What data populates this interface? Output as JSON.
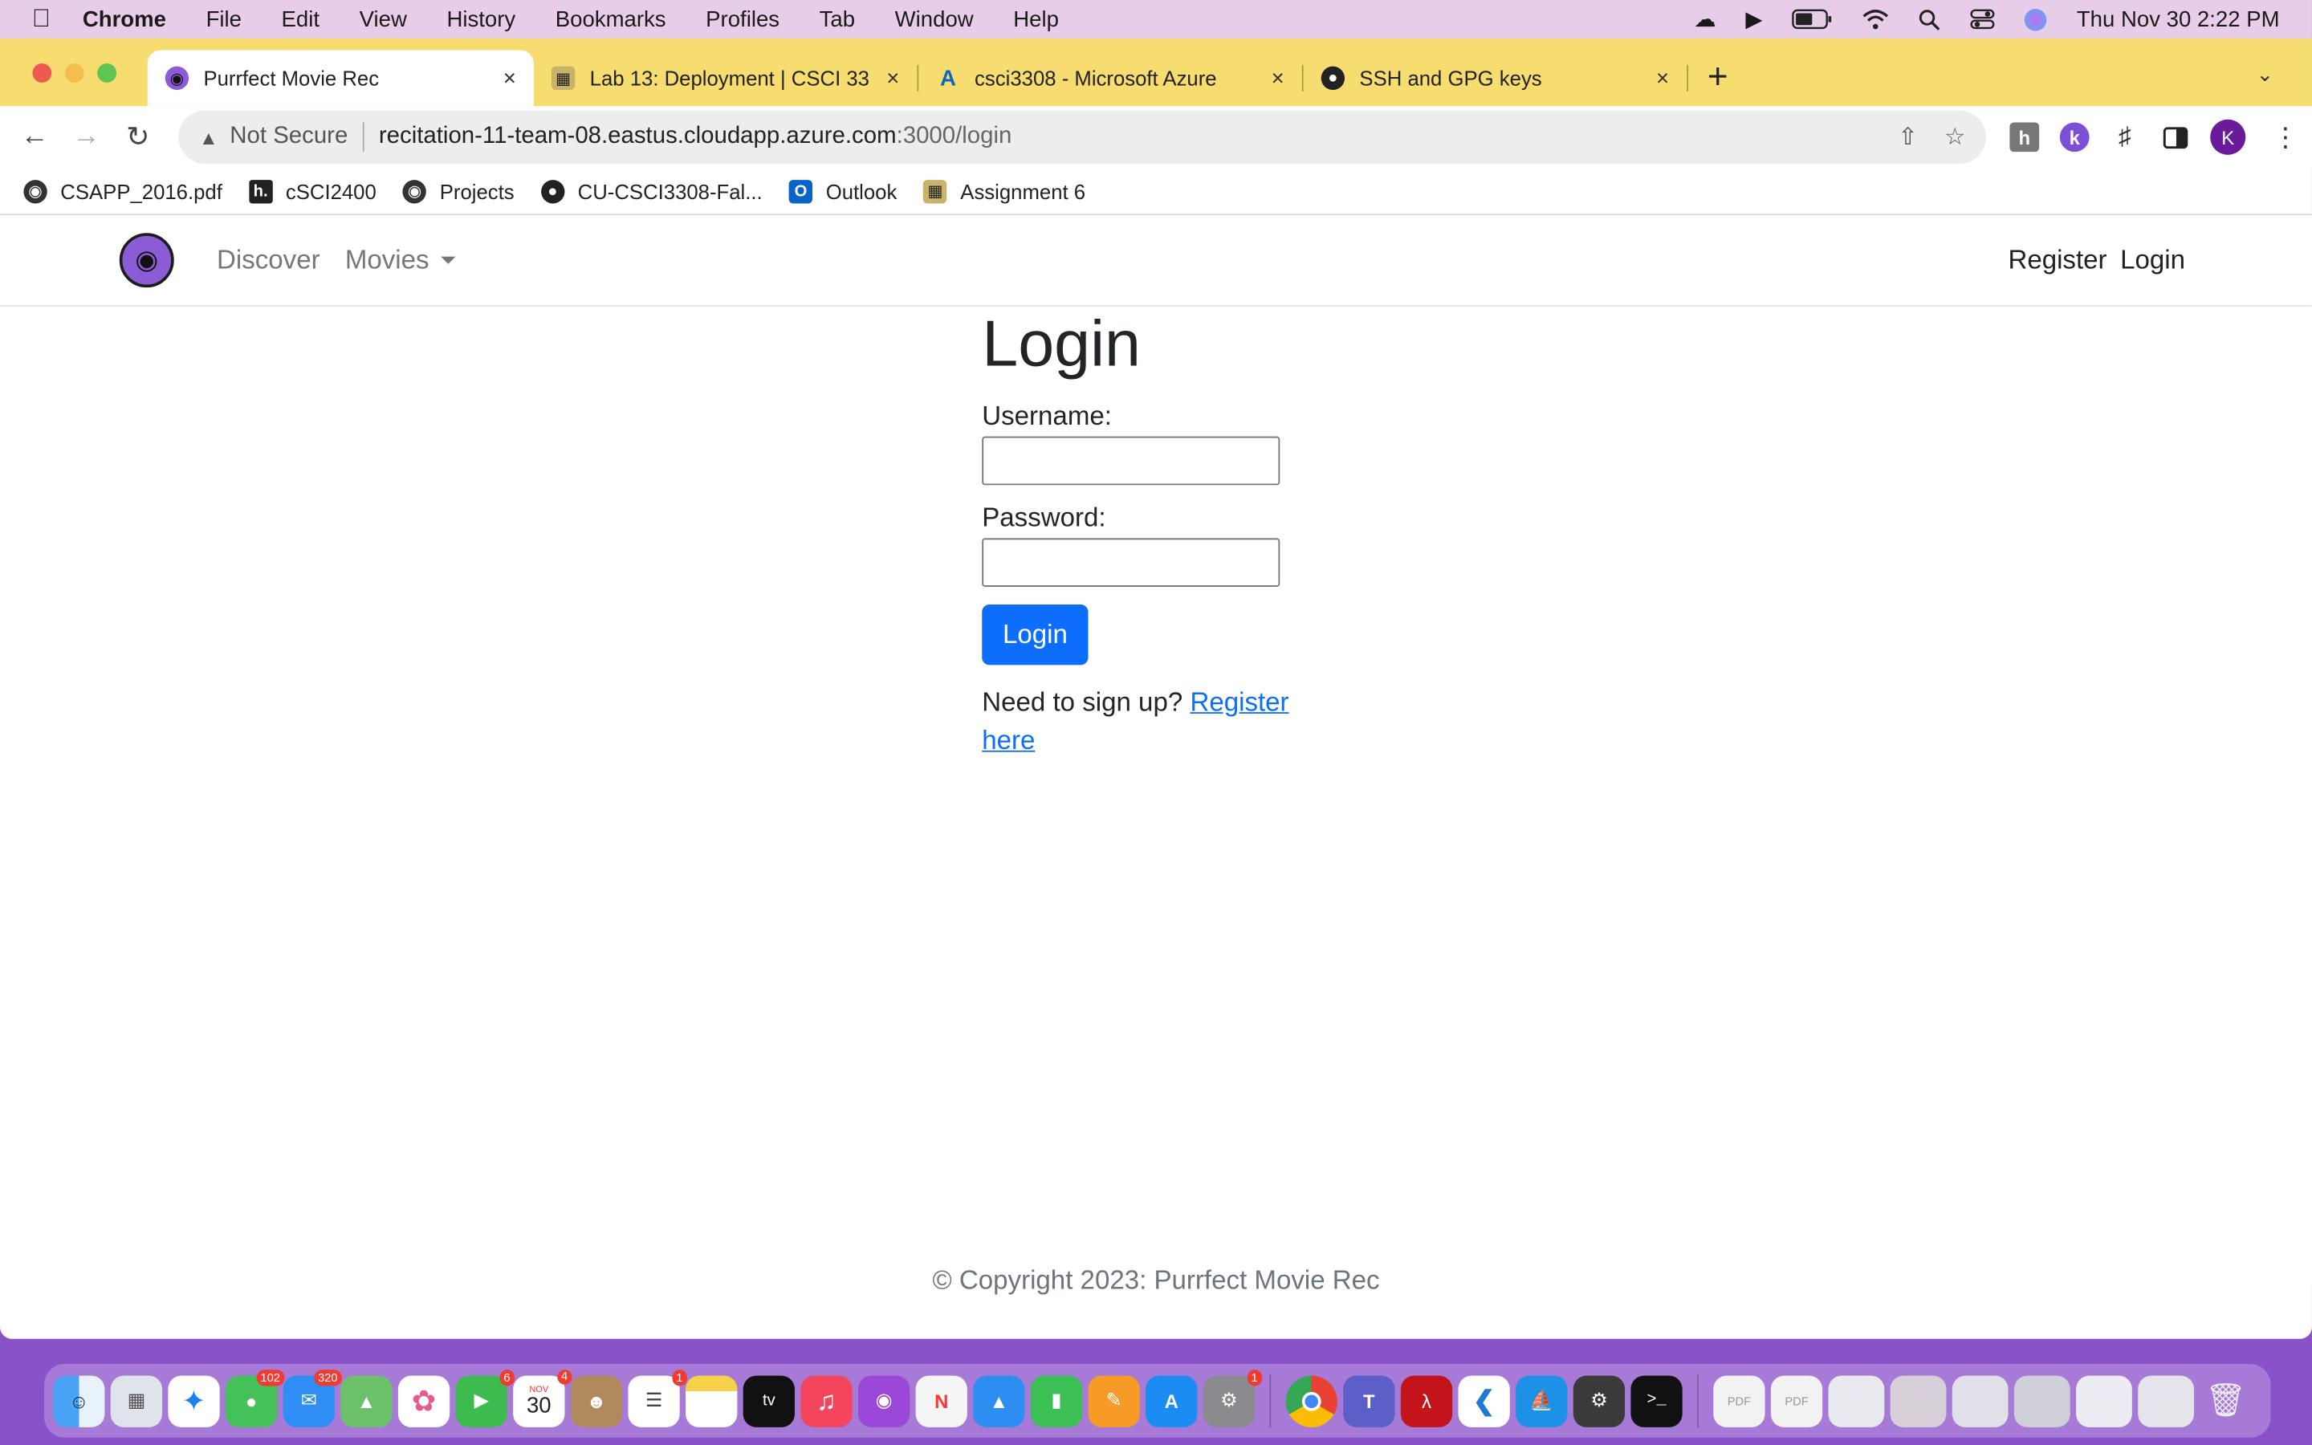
{
  "menubar": {
    "app_name": "Chrome",
    "items": [
      "File",
      "Edit",
      "View",
      "History",
      "Bookmarks",
      "Profiles",
      "Tab",
      "Window",
      "Help"
    ],
    "clock": "Thu Nov 30  2:22 PM"
  },
  "tabs": [
    {
      "title": "Purrfect Movie Rec",
      "close": "×"
    },
    {
      "title": "Lab 13: Deployment | CSCI 33",
      "close": "×"
    },
    {
      "title": "csci3308 - Microsoft Azure",
      "close": "×"
    },
    {
      "title": "SSH and GPG keys",
      "close": "×"
    }
  ],
  "toolbar": {
    "not_secure": "Not Secure",
    "url_host": "recitation-11-team-08.eastus.cloudapp.azure.com",
    "url_path": ":3000/login",
    "profile_initial": "K"
  },
  "bookmarks": [
    "CSAPP_2016.pdf",
    "cSCI2400",
    "Projects",
    "CU-CSCI3308-Fal...",
    "Outlook",
    "Assignment 6"
  ],
  "site_nav": {
    "discover": "Discover",
    "movies": "Movies",
    "register": "Register",
    "login": "Login"
  },
  "login_form": {
    "heading": "Login",
    "username_label": "Username:",
    "password_label": "Password:",
    "submit_label": "Login",
    "signup_prompt": "Need to sign up?",
    "signup_link": "Register here"
  },
  "footer": {
    "copyright": "© Copyright 2023: Purrfect Movie Rec"
  },
  "dock_badges": {
    "messages": "102",
    "mail": "320",
    "facetime": "6",
    "calendar_day": "30",
    "calendar_month": "NOV",
    "calendar_badge": "4",
    "reminders": "1",
    "settings": "1"
  },
  "colors": {
    "accent": "#0d6efd",
    "tabstrip": "#f7dc6f",
    "menubar": "#e8cde8",
    "logo": "#8b5cd6"
  }
}
